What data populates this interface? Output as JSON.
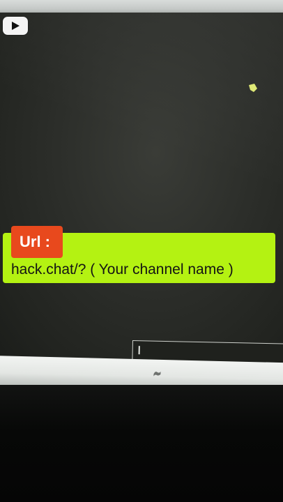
{
  "overlay": {
    "url_tag_label": "Url :",
    "caption_text": "hack.chat/? ( Your channel name )"
  },
  "icons": {
    "play_badge": "play-icon",
    "cursor": "mouse-pointer-icon",
    "bezel_logo": "monitor-brand-logo-icon"
  },
  "chat": {
    "input_value": ""
  },
  "colors": {
    "url_tag_bg": "#e8491d",
    "caption_bg": "#b4f212",
    "screen_bg": "#2c2e2a",
    "cursor": "#e9f37a"
  }
}
